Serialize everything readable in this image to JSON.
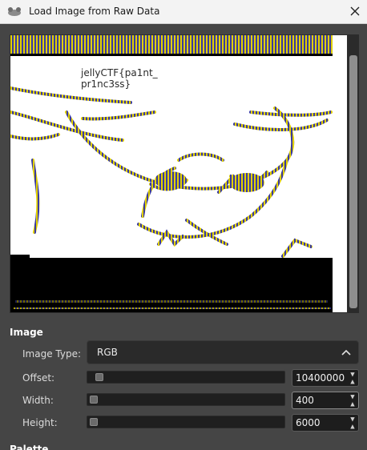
{
  "window": {
    "title": "Load Image from Raw Data"
  },
  "palette": {
    "section_label": "Palette",
    "height_label": "Height:",
    "height_value": "6000",
    "width_label": "Width:",
    "width_value": "400",
    "offset_label": "Offset:",
    "offset_value": "10400000",
    "image_type_label": "Image Type:",
    "image_type_value": "RGB"
  },
  "image": {
    "section_label": "Image",
    "flag_line1": "jellyCTF{pa1nt_",
    "flag_line2": "pr1nc3ss}"
  },
  "colors": {
    "background": "#454545",
    "preview_bg": "#ffffff",
    "stripe_yellow": "#e0d000",
    "stripe_blue": "#3a3aa0",
    "titlebar": "#f3f3f3"
  },
  "icons": {
    "app": "gimp-icon",
    "close": "close-icon",
    "spin": "spin-arrows-icon",
    "select": "chevron-icon"
  }
}
